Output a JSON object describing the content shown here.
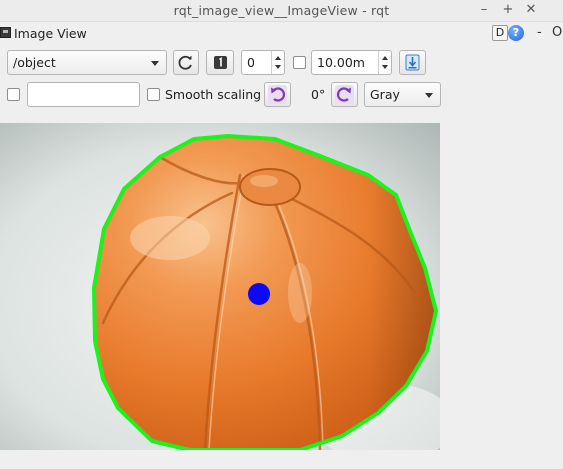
{
  "window": {
    "title": "rqt_image_view__ImageView - rqt",
    "controls": {
      "minimize": "–",
      "maximize": "+",
      "close": "✕"
    }
  },
  "panel": {
    "title": "Image View",
    "d_label": "D",
    "help_label": "?",
    "dash": "-",
    "undock": "O"
  },
  "toolbar": {
    "topic": "/object",
    "frame_value": "0",
    "max_range": "10.00m",
    "smooth_scaling_label": "Smooth scaling",
    "rotation_label": "0°",
    "color_scheme": "Gray",
    "text_field_value": ""
  },
  "image": {
    "subject": "orange leather ball",
    "contour_color": "#1cf21c",
    "centroid_color": "#0a0af5"
  }
}
